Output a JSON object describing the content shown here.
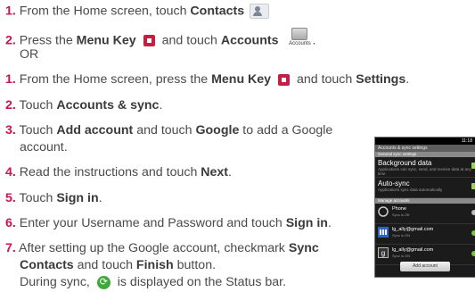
{
  "steps_a": {
    "s1": {
      "num": "1.",
      "pre": "From the Home screen, touch ",
      "b1": "Contacts"
    },
    "s2": {
      "num": "2.",
      "pre": "Press the ",
      "b1": "Menu Key",
      "mid": " and touch ",
      "b2": "Accounts",
      "icon_caption": "Accounts",
      "post": "."
    },
    "or": "OR"
  },
  "steps_b": {
    "s1": {
      "num": "1.",
      "pre": "From the Home screen, press the ",
      "b1": "Menu Key",
      "mid": " and touch ",
      "b2": "Settings",
      "post": "."
    },
    "s2": {
      "num": "2.",
      "pre": "Touch ",
      "b1": "Accounts & sync",
      "post": "."
    },
    "s3": {
      "num": "3.",
      "pre": "Touch ",
      "b1": "Add account",
      "mid": " and touch ",
      "b2": "Google",
      "post": " to add a Google",
      "cont": "account."
    },
    "s4": {
      "num": "4.",
      "pre": "Read the instructions and touch ",
      "b1": "Next",
      "post": "."
    },
    "s5": {
      "num": "5.",
      "pre": "Touch ",
      "b1": "Sign in",
      "post": "."
    },
    "s6": {
      "num": "6.",
      "pre": "Enter your Username and Password and touch ",
      "b1": "Sign in",
      "post": "."
    },
    "s7": {
      "num": "7.",
      "pre": "After setting up the Google account, checkmark ",
      "b1": "Sync",
      "b2": "Contacts",
      "mid": " and touch ",
      "b3": "Finish",
      "post": " button.",
      "cont_pre": "During sync, ",
      "cont_post": " is displayed on the Status bar."
    }
  },
  "icons": {
    "contacts": "contacts-icon",
    "menu_key": "menu-key-icon",
    "accounts": "accounts-icon",
    "sync": "sync-icon"
  },
  "colors": {
    "step_number": "#d0114c",
    "menu_key": "#c71d43",
    "sync_icon": "#3ea83a"
  },
  "phone": {
    "status_time": "11:18",
    "title": "Accounts & sync settings",
    "section1": "General sync settings",
    "background_data": {
      "title": "Background data",
      "sub": "Applications can sync, send, and receive data at any time"
    },
    "auto_sync": {
      "title": "Auto-sync",
      "sub": "Applications sync data automatically"
    },
    "section2": "Manage accounts",
    "accounts": [
      {
        "name": "Phone",
        "status": "Sync is Off"
      },
      {
        "name": "lg_ally@gmail.com",
        "status": "Sync is ON"
      },
      {
        "name": "lg_ally@gmail.com",
        "status": "Sync is ON"
      }
    ],
    "add_button": "Add account"
  }
}
